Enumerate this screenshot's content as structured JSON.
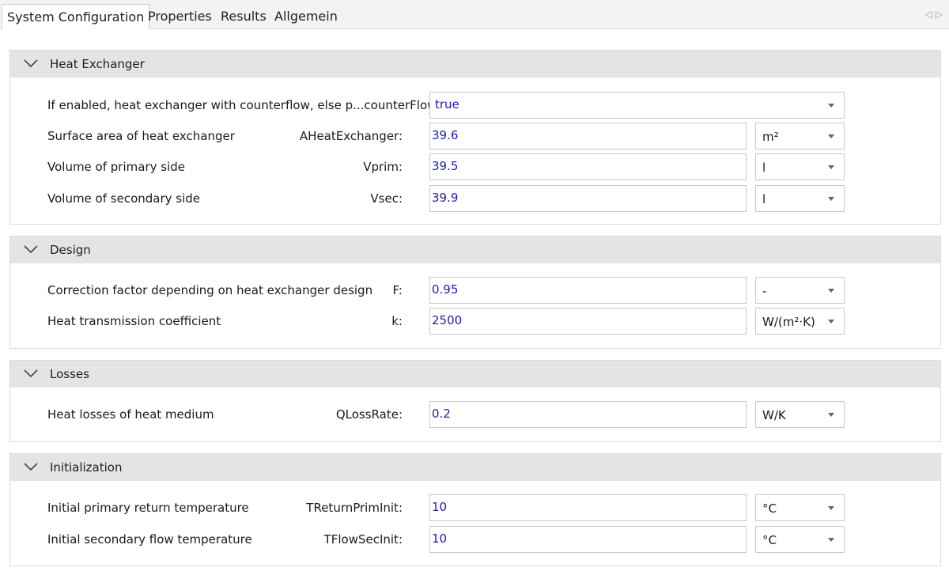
{
  "tabs": [
    {
      "label": "System Configuration",
      "active": true
    },
    {
      "label": "Properties"
    },
    {
      "label": "Results"
    },
    {
      "label": "Allgemein"
    }
  ],
  "colors": {
    "value_text": "#1e1ea8",
    "header_bg": "#e4e4e4"
  },
  "sections": [
    {
      "title": "Heat Exchanger",
      "rows": [
        {
          "desc": "If enabled, heat exchanger with counterflow, else p...counterFlow:",
          "param": "",
          "value": "true",
          "unit": null
        },
        {
          "desc": "Surface area of heat exchanger",
          "param": "AHeatExchanger:",
          "value": "39.6",
          "unit": "m²"
        },
        {
          "desc": "Volume of primary side",
          "param": "Vprim:",
          "value": "39.5",
          "unit": "l"
        },
        {
          "desc": "Volume of secondary side",
          "param": "Vsec:",
          "value": "39.9",
          "unit": "l"
        }
      ]
    },
    {
      "title": "Design",
      "rows": [
        {
          "desc": "Correction factor depending on heat exchanger design",
          "param": "F:",
          "value": "0.95",
          "unit": "-"
        },
        {
          "desc": "Heat transmission coefficient",
          "param": "k:",
          "value": "2500",
          "unit": "W/(m²·K)"
        }
      ]
    },
    {
      "title": "Losses",
      "rows": [
        {
          "desc": "Heat losses of heat medium",
          "param": "QLossRate:",
          "value": "0.2",
          "unit": "W/K"
        }
      ]
    },
    {
      "title": "Initialization",
      "rows": [
        {
          "desc": "Initial primary return temperature",
          "param": "TReturnPrimInit:",
          "value": "10",
          "unit": "°C"
        },
        {
          "desc": "Initial secondary flow temperature",
          "param": "TFlowSecInit:",
          "value": "10",
          "unit": "°C"
        }
      ]
    }
  ]
}
